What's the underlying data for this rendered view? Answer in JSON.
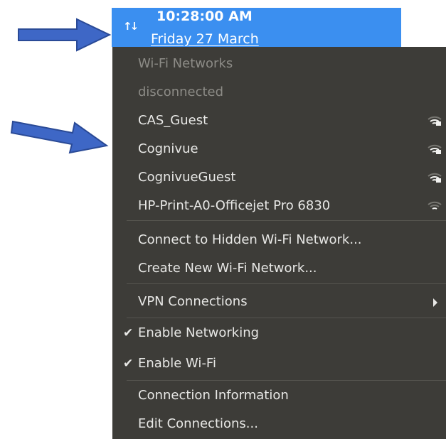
{
  "clock": {
    "time": "10:28:00 AM",
    "date": "Friday 27 March"
  },
  "colors": {
    "topbar": "#3b8ff0",
    "menu_bg": "#3d3c38",
    "menu_text": "#e8e8e6",
    "disabled_text": "#8c8b86",
    "arrow_fill": "#3e67c6"
  },
  "icons": {
    "network_indicator": "network-transfer-icon",
    "wifi_signal": "wifi-signal-icon",
    "submenu": "chevron-right-icon",
    "check": "checkmark-icon"
  },
  "menu": {
    "section_header": "Wi-Fi Networks",
    "status": "disconnected",
    "networks": [
      {
        "ssid": "CAS_Guest",
        "signal": 0.75,
        "secured": true
      },
      {
        "ssid": "Cognivue",
        "signal": 0.75,
        "secured": true
      },
      {
        "ssid": "CognivueGuest",
        "signal": 0.75,
        "secured": true
      },
      {
        "ssid": "HP-Print-A0-Officejet Pro 6830",
        "signal": 0.5,
        "secured": false
      }
    ],
    "connect_hidden": "Connect to Hidden Wi-Fi Network...",
    "create_new": "Create New Wi-Fi Network...",
    "vpn": "VPN Connections",
    "enable_networking": {
      "label": "Enable Networking",
      "checked": true
    },
    "enable_wifi": {
      "label": "Enable Wi-Fi",
      "checked": true
    },
    "connection_info": "Connection Information",
    "edit_connections": "Edit Connections..."
  }
}
